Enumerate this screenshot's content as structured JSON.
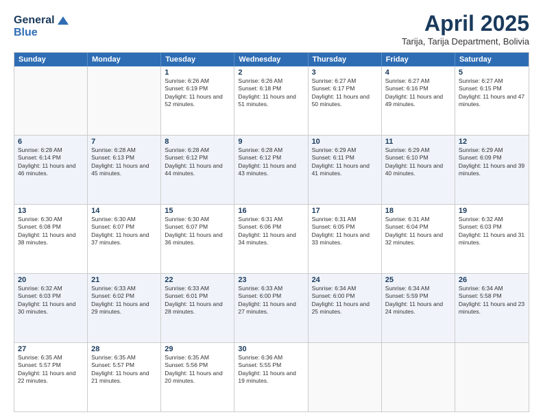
{
  "logo": {
    "line1": "General",
    "line2": "Blue"
  },
  "title": "April 2025",
  "location": "Tarija, Tarija Department, Bolivia",
  "days_of_week": [
    "Sunday",
    "Monday",
    "Tuesday",
    "Wednesday",
    "Thursday",
    "Friday",
    "Saturday"
  ],
  "weeks": [
    [
      {
        "day": "",
        "info": ""
      },
      {
        "day": "",
        "info": ""
      },
      {
        "day": "1",
        "info": "Sunrise: 6:26 AM\nSunset: 6:19 PM\nDaylight: 11 hours and 52 minutes."
      },
      {
        "day": "2",
        "info": "Sunrise: 6:26 AM\nSunset: 6:18 PM\nDaylight: 11 hours and 51 minutes."
      },
      {
        "day": "3",
        "info": "Sunrise: 6:27 AM\nSunset: 6:17 PM\nDaylight: 11 hours and 50 minutes."
      },
      {
        "day": "4",
        "info": "Sunrise: 6:27 AM\nSunset: 6:16 PM\nDaylight: 11 hours and 49 minutes."
      },
      {
        "day": "5",
        "info": "Sunrise: 6:27 AM\nSunset: 6:15 PM\nDaylight: 11 hours and 47 minutes."
      }
    ],
    [
      {
        "day": "6",
        "info": "Sunrise: 6:28 AM\nSunset: 6:14 PM\nDaylight: 11 hours and 46 minutes."
      },
      {
        "day": "7",
        "info": "Sunrise: 6:28 AM\nSunset: 6:13 PM\nDaylight: 11 hours and 45 minutes."
      },
      {
        "day": "8",
        "info": "Sunrise: 6:28 AM\nSunset: 6:12 PM\nDaylight: 11 hours and 44 minutes."
      },
      {
        "day": "9",
        "info": "Sunrise: 6:28 AM\nSunset: 6:12 PM\nDaylight: 11 hours and 43 minutes."
      },
      {
        "day": "10",
        "info": "Sunrise: 6:29 AM\nSunset: 6:11 PM\nDaylight: 11 hours and 41 minutes."
      },
      {
        "day": "11",
        "info": "Sunrise: 6:29 AM\nSunset: 6:10 PM\nDaylight: 11 hours and 40 minutes."
      },
      {
        "day": "12",
        "info": "Sunrise: 6:29 AM\nSunset: 6:09 PM\nDaylight: 11 hours and 39 minutes."
      }
    ],
    [
      {
        "day": "13",
        "info": "Sunrise: 6:30 AM\nSunset: 6:08 PM\nDaylight: 11 hours and 38 minutes."
      },
      {
        "day": "14",
        "info": "Sunrise: 6:30 AM\nSunset: 6:07 PM\nDaylight: 11 hours and 37 minutes."
      },
      {
        "day": "15",
        "info": "Sunrise: 6:30 AM\nSunset: 6:07 PM\nDaylight: 11 hours and 36 minutes."
      },
      {
        "day": "16",
        "info": "Sunrise: 6:31 AM\nSunset: 6:06 PM\nDaylight: 11 hours and 34 minutes."
      },
      {
        "day": "17",
        "info": "Sunrise: 6:31 AM\nSunset: 6:05 PM\nDaylight: 11 hours and 33 minutes."
      },
      {
        "day": "18",
        "info": "Sunrise: 6:31 AM\nSunset: 6:04 PM\nDaylight: 11 hours and 32 minutes."
      },
      {
        "day": "19",
        "info": "Sunrise: 6:32 AM\nSunset: 6:03 PM\nDaylight: 11 hours and 31 minutes."
      }
    ],
    [
      {
        "day": "20",
        "info": "Sunrise: 6:32 AM\nSunset: 6:03 PM\nDaylight: 11 hours and 30 minutes."
      },
      {
        "day": "21",
        "info": "Sunrise: 6:33 AM\nSunset: 6:02 PM\nDaylight: 11 hours and 29 minutes."
      },
      {
        "day": "22",
        "info": "Sunrise: 6:33 AM\nSunset: 6:01 PM\nDaylight: 11 hours and 28 minutes."
      },
      {
        "day": "23",
        "info": "Sunrise: 6:33 AM\nSunset: 6:00 PM\nDaylight: 11 hours and 27 minutes."
      },
      {
        "day": "24",
        "info": "Sunrise: 6:34 AM\nSunset: 6:00 PM\nDaylight: 11 hours and 25 minutes."
      },
      {
        "day": "25",
        "info": "Sunrise: 6:34 AM\nSunset: 5:59 PM\nDaylight: 11 hours and 24 minutes."
      },
      {
        "day": "26",
        "info": "Sunrise: 6:34 AM\nSunset: 5:58 PM\nDaylight: 11 hours and 23 minutes."
      }
    ],
    [
      {
        "day": "27",
        "info": "Sunrise: 6:35 AM\nSunset: 5:57 PM\nDaylight: 11 hours and 22 minutes."
      },
      {
        "day": "28",
        "info": "Sunrise: 6:35 AM\nSunset: 5:57 PM\nDaylight: 11 hours and 21 minutes."
      },
      {
        "day": "29",
        "info": "Sunrise: 6:35 AM\nSunset: 5:56 PM\nDaylight: 11 hours and 20 minutes."
      },
      {
        "day": "30",
        "info": "Sunrise: 6:36 AM\nSunset: 5:55 PM\nDaylight: 11 hours and 19 minutes."
      },
      {
        "day": "",
        "info": ""
      },
      {
        "day": "",
        "info": ""
      },
      {
        "day": "",
        "info": ""
      }
    ]
  ]
}
